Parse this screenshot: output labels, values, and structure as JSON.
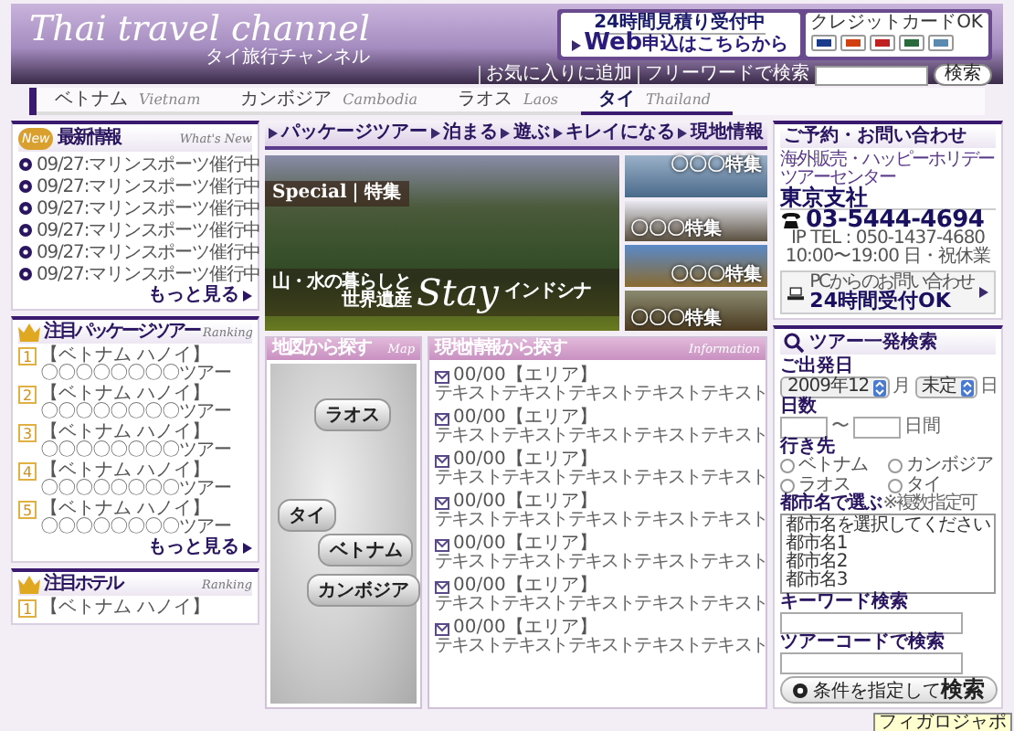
{
  "header": {
    "title": "Thai travel channel",
    "subtitle": "タイ旅行チャンネル",
    "banner": {
      "line1": "24時間見積り受付中",
      "line2": "**Web**申込はこちらから"
    },
    "cards_label": "クレジットカードOK",
    "links": [
      "お気に入りに追加",
      "フリーワードで検索"
    ],
    "search_button": "検索"
  },
  "country_tabs": [
    {
      "label": "ベトナム",
      "label_en": "Vietnam",
      "selected": false
    },
    {
      "label": "カンボジア",
      "label_en": "Cambodia",
      "selected": false
    },
    {
      "label": "ラオス",
      "label_en": "Laos",
      "selected": false
    },
    {
      "label": "タイ",
      "label_en": "Thailand",
      "selected": true
    }
  ],
  "news": {
    "badge": "New",
    "title": "最新情報",
    "title_en": "What's New",
    "items": [
      "09/27:マリンスポーツ催行中",
      "09/27:マリンスポーツ催行中",
      "09/27:マリンスポーツ催行中",
      "09/27:マリンスポーツ催行中",
      "09/27:マリンスポーツ催行中",
      "09/27:マリンスポーツ催行中"
    ],
    "more": "もっと見る"
  },
  "package_ranking": {
    "title": "注目パッケージツアー",
    "title_en": "Ranking",
    "items": [
      {
        "rank": "1",
        "area": "【ベトナム ハノイ】",
        "name": "〇〇〇〇〇〇〇〇ツアー"
      },
      {
        "rank": "2",
        "area": "【ベトナム ハノイ】",
        "name": "〇〇〇〇〇〇〇〇ツアー"
      },
      {
        "rank": "3",
        "area": "【ベトナム ハノイ】",
        "name": "〇〇〇〇〇〇〇〇ツアー"
      },
      {
        "rank": "4",
        "area": "【ベトナム ハノイ】",
        "name": "〇〇〇〇〇〇〇〇ツアー"
      },
      {
        "rank": "5",
        "area": "【ベトナム ハノイ】",
        "name": "〇〇〇〇〇〇〇〇ツアー"
      }
    ],
    "more": "もっと見る"
  },
  "hotel_ranking": {
    "title": "注目ホテル",
    "title_en": "Ranking",
    "items": [
      {
        "rank": "1",
        "area": "【ベトナム ハノイ】"
      }
    ]
  },
  "menu": [
    "パッケージツアー",
    "泊まる",
    "遊ぶ",
    "キレイになる",
    "現地情報"
  ],
  "feature": {
    "badge": "Special｜特集",
    "caption_1": "山・水の暮らしと",
    "caption_2": "世界遺産",
    "script": "Stay",
    "region": "インドシナ",
    "thumbnails": [
      "〇〇〇特集",
      "〇〇〇特集",
      "〇〇〇特集",
      "〇〇〇特集"
    ]
  },
  "map": {
    "title": "地図から探す",
    "title_en": "Map",
    "labels": [
      "ラオス",
      "タイ",
      "ベトナム",
      "カンボジア"
    ]
  },
  "info": {
    "title": "現地情報から探す",
    "title_en": "Information",
    "items": [
      {
        "heading": "00/00【エリア】",
        "text": "テキストテキストテキストテキストテキスト"
      },
      {
        "heading": "00/00【エリア】",
        "text": "テキストテキストテキストテキストテキスト"
      },
      {
        "heading": "00/00【エリア】",
        "text": "テキストテキストテキストテキストテキスト"
      },
      {
        "heading": "00/00【エリア】",
        "text": "テキストテキストテキストテキストテキスト"
      },
      {
        "heading": "00/00【エリア】",
        "text": "テキストテキストテキストテキストテキスト"
      },
      {
        "heading": "00/00【エリア】",
        "text": "テキストテキストテキストテキストテキスト"
      },
      {
        "heading": "00/00【エリア】",
        "text": "テキストテキストテキストテキストテキスト"
      }
    ]
  },
  "contact": {
    "title": "ご予約・お問い合わせ",
    "center": "海外販売・ハッピーホリデーツアーセンター",
    "branch": "東京支社",
    "phone": "03-5444-4694",
    "ip_tel": "IP TEL : 050-1437-4680",
    "hours": "10:00〜19:00 日・祝休業",
    "pc_note": "PCからのお問い合わせ",
    "pc_hours": "24時間受付OK"
  },
  "tour_search": {
    "title": "ツアー一発検索",
    "departure_label": "ご出発日",
    "month_value": "2009年12",
    "month_unit": "月",
    "day_value": "未定",
    "day_unit": "日",
    "days_label": "日数",
    "days_sep": "〜",
    "days_unit": "日間",
    "destination_label": "行き先",
    "destinations": [
      {
        "label": "ベトナム",
        "selected": false
      },
      {
        "label": "カンボジア",
        "selected": false
      },
      {
        "label": "ラオス",
        "selected": false
      },
      {
        "label": "タイ",
        "selected": false
      }
    ],
    "city_label": "都市名で選ぶ",
    "city_note": "※複数指定可",
    "cities": [
      "都市名を選択してください",
      "都市名1",
      "都市名2",
      "都市名3"
    ],
    "keyword_label": "キーワード検索",
    "code_label": "ツアーコードで検索",
    "button": "条件を指定して**検索**"
  },
  "tooltip": "フィガロジャポ"
}
